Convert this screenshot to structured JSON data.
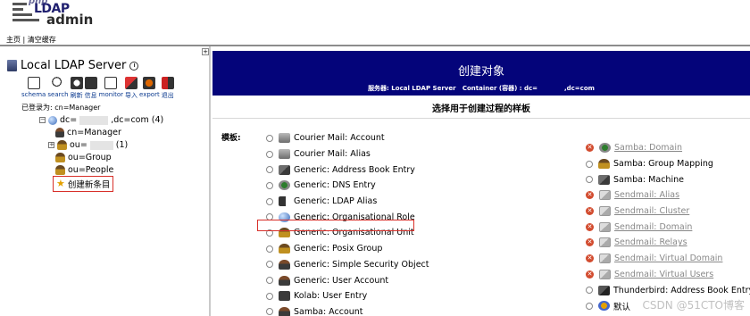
{
  "logo": {
    "php": "php",
    "ldap": "LDAP",
    "admin": "admin"
  },
  "topnav": {
    "home": "主页",
    "sep": "|",
    "clear_cache": "清空缓存"
  },
  "server": {
    "name": "Local LDAP Server"
  },
  "toolbar": [
    {
      "label": "schema",
      "icon": "schema-icon"
    },
    {
      "label": "search",
      "icon": "search-icon"
    },
    {
      "label": "刷新",
      "icon": "refresh-icon"
    },
    {
      "label": "信息",
      "icon": "info-icon"
    },
    {
      "label": "monitor",
      "icon": "monitor-icon"
    },
    {
      "label": "导入",
      "icon": "import-icon"
    },
    {
      "label": "export",
      "icon": "export-icon"
    },
    {
      "label": "退出",
      "icon": "logout-icon"
    }
  ],
  "login": "已登录为: cn=Manager",
  "tree": {
    "root": {
      "prefix": "dc=",
      "suffix": ",dc=com (4)"
    },
    "items": [
      {
        "label": "cn=Manager"
      },
      {
        "prefix": "ou=",
        "suffix": "(1)"
      },
      {
        "label": "ou=Group"
      },
      {
        "label": "ou=People"
      }
    ],
    "create": "创建新条目"
  },
  "banner": {
    "title": "创建对象",
    "server_label": "服务器: Local LDAP Server",
    "container_prefix": "Container (容器) : dc=",
    "container_suffix": ",dc=com"
  },
  "choose_title": "选择用于创建过程的样板",
  "template_label": "模板:",
  "templates_left": [
    {
      "label": "Courier Mail: Account",
      "icon": "mail-icon"
    },
    {
      "label": "Courier Mail: Alias",
      "icon": "mail-icon"
    },
    {
      "label": "Generic: Address Book Entry",
      "icon": "address-book-icon"
    },
    {
      "label": "Generic: DNS Entry",
      "icon": "dns-icon"
    },
    {
      "label": "Generic: LDAP Alias",
      "icon": "alias-icon"
    },
    {
      "label": "Generic: Organisational Role",
      "icon": "role-icon"
    },
    {
      "label": "Generic: Organisational Unit",
      "icon": "unit-icon"
    },
    {
      "label": "Generic: Posix Group",
      "icon": "group-icon"
    },
    {
      "label": "Generic: Simple Security Object",
      "icon": "person-icon"
    },
    {
      "label": "Generic: User Account",
      "icon": "person-icon"
    },
    {
      "label": "Kolab: User Entry",
      "icon": "kolab-icon"
    },
    {
      "label": "Samba: Account",
      "icon": "person-icon"
    }
  ],
  "templates_right": [
    {
      "label": "Samba: Domain",
      "icon": "dns-icon",
      "disabled": true
    },
    {
      "label": "Samba: Group Mapping",
      "icon": "group-icon",
      "disabled": false
    },
    {
      "label": "Samba: Machine",
      "icon": "machine-icon",
      "disabled": false
    },
    {
      "label": "Sendmail: Alias",
      "icon": "envelope-icon",
      "disabled": true
    },
    {
      "label": "Sendmail: Cluster",
      "icon": "envelope-icon",
      "disabled": true
    },
    {
      "label": "Sendmail: Domain",
      "icon": "envelope-icon",
      "disabled": true
    },
    {
      "label": "Sendmail: Relays",
      "icon": "envelope-icon",
      "disabled": true
    },
    {
      "label": "Sendmail: Virtual Domain",
      "icon": "envelope-icon",
      "disabled": true
    },
    {
      "label": "Sendmail: Virtual Users",
      "icon": "envelope-icon",
      "disabled": true
    },
    {
      "label": "Thunderbird: Address Book Entry",
      "icon": "thunderbird-icon",
      "disabled": false
    },
    {
      "label": "默认",
      "icon": "default-icon",
      "disabled": false
    }
  ],
  "watermark": "CSDN @51CTO博客",
  "colors": {
    "banner": "#04047a",
    "highlight": "#d8302a",
    "disabled_badge": "#d24b2e"
  }
}
